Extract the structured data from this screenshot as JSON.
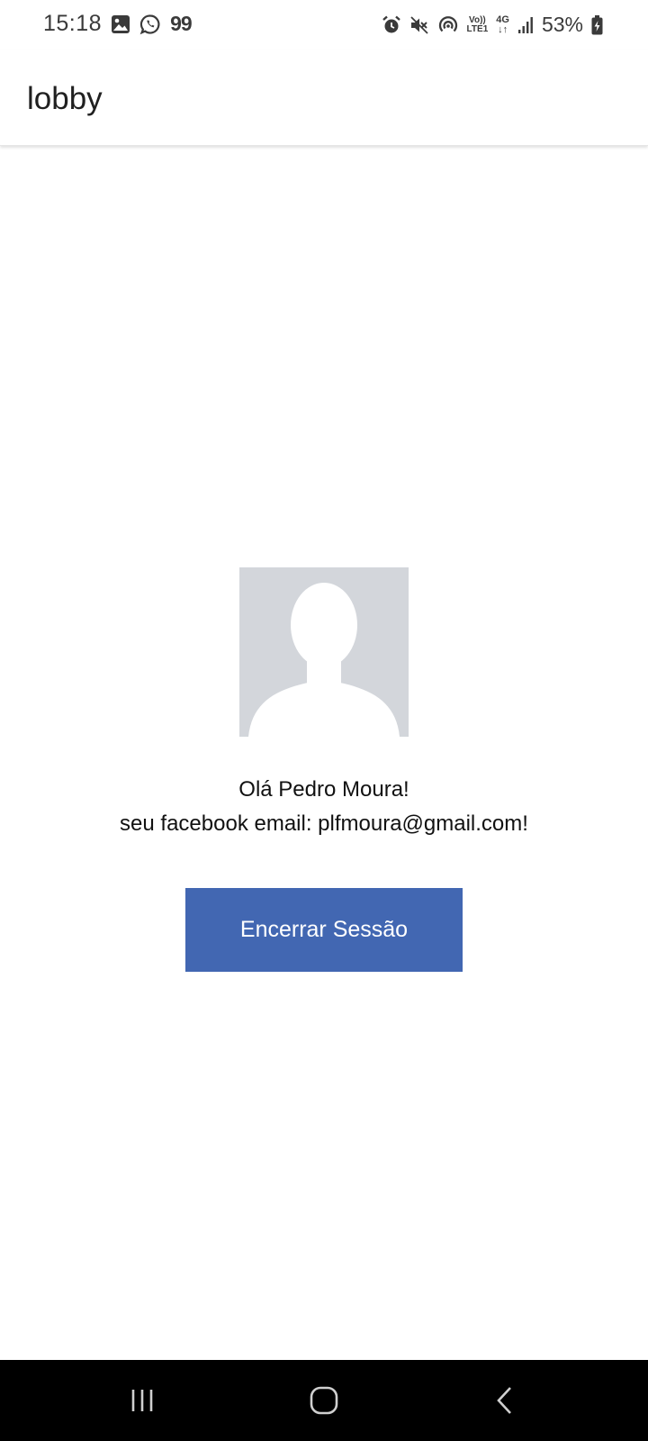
{
  "status_bar": {
    "time": "15:18",
    "notification_icons": [
      "image-icon",
      "whatsapp-icon"
    ],
    "notification_count": "99",
    "volte_line1": "Vo))",
    "volte_line2": "LTE1",
    "network_type": "4G",
    "battery": "53%"
  },
  "app_bar": {
    "title": "lobby"
  },
  "profile": {
    "avatar": "default-profile-silhouette",
    "greeting": "Olá Pedro Moura!",
    "email_line": "seu facebook email: plfmoura@gmail.com!"
  },
  "actions": {
    "logout_label": "Encerrar Sessão"
  },
  "nav_bar": {
    "buttons": [
      "recent-apps-icon",
      "home-icon",
      "back-icon"
    ]
  },
  "colors": {
    "button_background": "#4267b2",
    "button_text": "#ffffff",
    "avatar_background": "#d3d6db",
    "nav_background": "#000000"
  }
}
